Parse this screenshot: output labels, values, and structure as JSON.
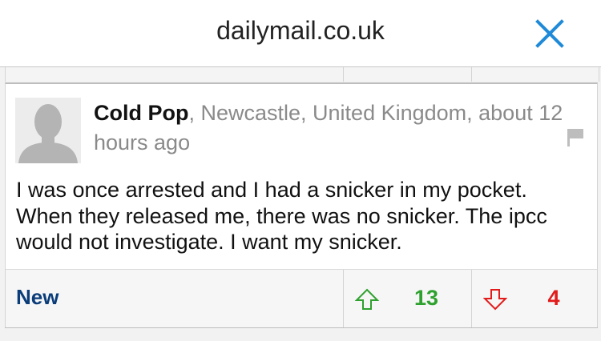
{
  "header": {
    "site_title": "dailymail.co.uk"
  },
  "comment": {
    "author": "Cold Pop",
    "location_time": ", Newcastle, United Kingdom, about 12 hours ago",
    "body": "I was once arrested and I had a snicker in my pocket. When they released me, there was no snicker. The ipcc would not investigate. I want my snicker.",
    "icons": {
      "avatar": "person-silhouette-icon",
      "report": "flag-icon"
    }
  },
  "actions": {
    "new_label": "New",
    "upvotes": "13",
    "downvotes": "4",
    "icons": {
      "up": "arrow-up-icon",
      "down": "arrow-down-icon",
      "close": "close-icon"
    }
  },
  "colors": {
    "close": "#1f8ad8",
    "new_link": "#0a3d7a",
    "upvote": "#2ea12e",
    "downvote": "#e21b1b",
    "muted_text": "#8a8a8a"
  }
}
